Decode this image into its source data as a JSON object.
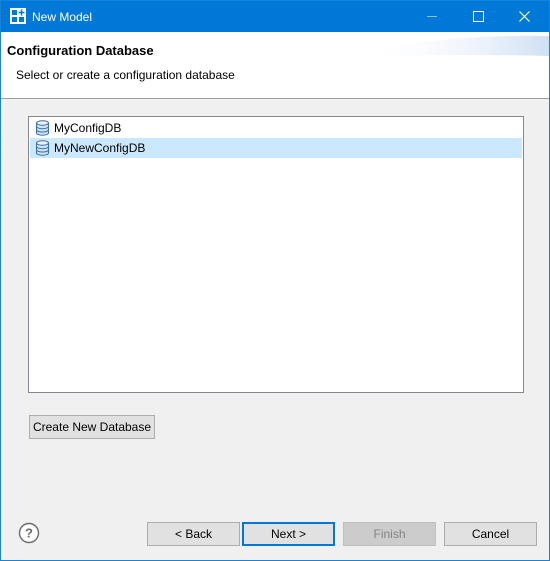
{
  "window": {
    "title": "New Model",
    "accent_color": "#0078d7"
  },
  "header": {
    "title": "Configuration Database",
    "message": "Select or create a configuration database"
  },
  "databases": [
    {
      "label": "MyConfigDB",
      "icon": "database-icon",
      "selected": false
    },
    {
      "label": "MyNewConfigDB",
      "icon": "database-icon",
      "selected": true
    }
  ],
  "actions": {
    "create_label": "Create New Database"
  },
  "footer": {
    "help_icon": "help-icon",
    "back_label": "< Back",
    "next_label": "Next >",
    "finish_label": "Finish",
    "cancel_label": "Cancel"
  }
}
